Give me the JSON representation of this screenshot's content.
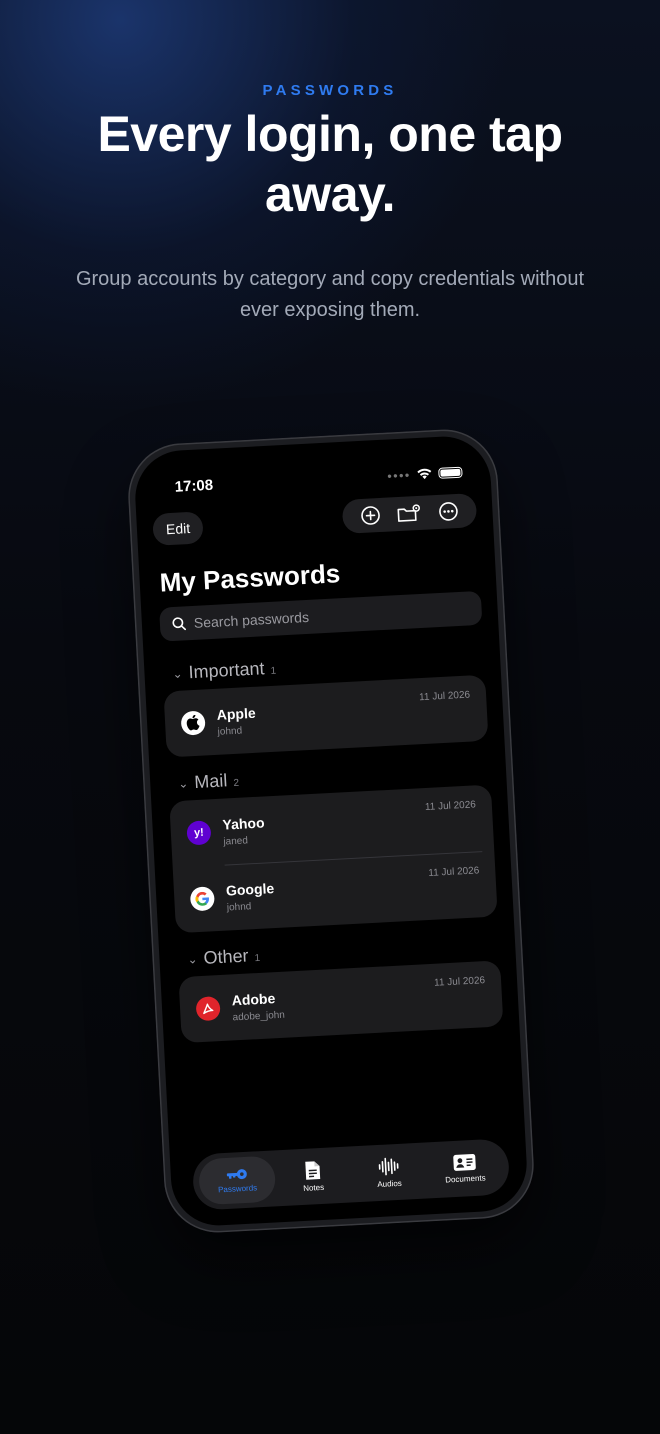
{
  "hero": {
    "eyebrow": "PASSWORDS",
    "headline": "Every login, one tap away.",
    "subhead": "Group accounts by category and copy credentials without ever exposing them."
  },
  "status_bar": {
    "time": "17:08"
  },
  "toolbar": {
    "edit_label": "Edit"
  },
  "page": {
    "title": "My Passwords"
  },
  "search": {
    "placeholder": "Search passwords"
  },
  "sections": [
    {
      "name": "Important",
      "count": "1",
      "items": [
        {
          "name": "Apple",
          "user": "johnd",
          "date": "11 Jul 2026",
          "icon": "apple-icon"
        }
      ]
    },
    {
      "name": "Mail",
      "count": "2",
      "items": [
        {
          "name": "Yahoo",
          "user": "janed",
          "date": "11 Jul 2026",
          "icon": "yahoo-icon"
        },
        {
          "name": "Google",
          "user": "johnd",
          "date": "11 Jul 2026",
          "icon": "google-icon"
        }
      ]
    },
    {
      "name": "Other",
      "count": "1",
      "items": [
        {
          "name": "Adobe",
          "user": "adobe_john",
          "date": "11 Jul 2026",
          "icon": "adobe-icon"
        }
      ]
    }
  ],
  "tabs": [
    {
      "label": "Passwords",
      "icon": "key-icon",
      "active": true
    },
    {
      "label": "Notes",
      "icon": "note-icon",
      "active": false
    },
    {
      "label": "Audios",
      "icon": "waveform-icon",
      "active": false
    },
    {
      "label": "Documents",
      "icon": "id-card-icon",
      "active": false
    }
  ],
  "colors": {
    "accent": "#2f7bf0",
    "card": "#1c1c1e",
    "screen": "#000000"
  }
}
